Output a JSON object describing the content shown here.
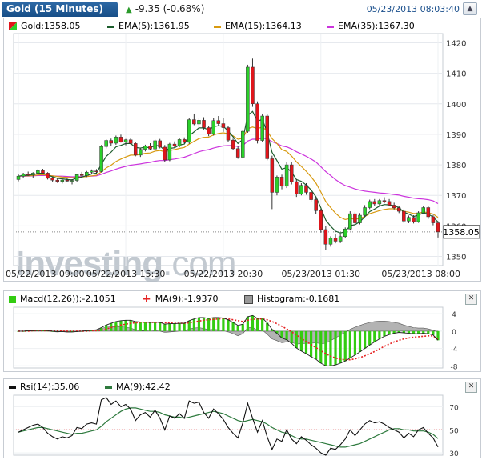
{
  "header": {
    "title": "Gold (15 Minutes)",
    "change": "-9.35 (-0.68%)",
    "timestamp": "05/23/2013 08:03:40"
  },
  "colors": {
    "up": "#2ad12a",
    "down": "#e0151b",
    "ema5": "#1c5c2c",
    "ema15": "#d89a10",
    "ema35": "#cc33dd",
    "macd_up": "#33cc11",
    "signal": "#e52222",
    "histogram": "#999999",
    "rsi": "#111111",
    "rsi_ma": "#2e7a3e"
  },
  "price_legend": {
    "gold": "Gold:1358.05",
    "ema5": "EMA(5):1361.95",
    "ema15": "EMA(15):1364.13",
    "ema35": "EMA(35):1367.30"
  },
  "macd_legend": {
    "macd": "Macd(12,26)):-2.1051",
    "ma": "MA(9):-1.9370",
    "histogram": "Histogram:-0.1681"
  },
  "rsi_legend": {
    "rsi": "Rsi(14):35.06",
    "ma": "MA(9):42.42"
  },
  "watermark": {
    "text": "Investing",
    "suffix": ".com"
  },
  "chart_data": [
    {
      "type": "candlestick",
      "title": "Gold (15 Minutes)",
      "ylim": [
        1347,
        1423
      ],
      "y_ticks": [
        1350,
        1360,
        1370,
        1380,
        1390,
        1400,
        1410,
        1420
      ],
      "x_tick_labels": [
        "05/22/2013 09:00",
        "05/22/2013 15:30",
        "05/22/2013 20:30",
        "05/23/2013 01:30",
        "05/23/2013 08:00"
      ],
      "last_price": "1358.05",
      "last_value": 1358.05,
      "reference_line": 1358.05,
      "ohlc": [
        [
          1375.2,
          1377.0,
          1374.6,
          1376.3
        ],
        [
          1376.3,
          1377.4,
          1375.7,
          1376.9
        ],
        [
          1376.9,
          1377.8,
          1376.4,
          1376.7
        ],
        [
          1376.7,
          1377.6,
          1375.8,
          1377.3
        ],
        [
          1377.3,
          1378.6,
          1376.9,
          1378.1
        ],
        [
          1378.1,
          1378.7,
          1376.9,
          1377.3
        ],
        [
          1377.3,
          1377.6,
          1375.2,
          1375.6
        ],
        [
          1375.6,
          1376.0,
          1374.4,
          1375.0
        ],
        [
          1375.0,
          1375.6,
          1374.1,
          1374.6
        ],
        [
          1374.6,
          1375.3,
          1373.9,
          1375.0
        ],
        [
          1375.0,
          1375.8,
          1374.4,
          1374.7
        ],
        [
          1374.7,
          1375.3,
          1373.6,
          1374.9
        ],
        [
          1374.9,
          1377.1,
          1374.5,
          1376.8
        ],
        [
          1376.8,
          1377.7,
          1376.2,
          1376.5
        ],
        [
          1376.5,
          1378.0,
          1376.0,
          1377.6
        ],
        [
          1377.6,
          1378.5,
          1376.9,
          1378.0
        ],
        [
          1378.0,
          1378.6,
          1377.3,
          1377.8
        ],
        [
          1377.8,
          1386.5,
          1377.5,
          1386.0
        ],
        [
          1386.0,
          1388.4,
          1385.4,
          1388.0
        ],
        [
          1388.0,
          1388.6,
          1386.1,
          1387.1
        ],
        [
          1387.1,
          1389.6,
          1386.6,
          1389.1
        ],
        [
          1389.1,
          1389.9,
          1387.3,
          1387.5
        ],
        [
          1387.5,
          1388.5,
          1386.4,
          1388.2
        ],
        [
          1388.2,
          1388.7,
          1386.7,
          1387.0
        ],
        [
          1387.0,
          1387.5,
          1382.8,
          1383.2
        ],
        [
          1383.2,
          1385.6,
          1382.6,
          1385.1
        ],
        [
          1385.1,
          1386.6,
          1384.4,
          1386.2
        ],
        [
          1386.2,
          1387.1,
          1384.8,
          1385.2
        ],
        [
          1385.2,
          1388.3,
          1384.8,
          1387.9
        ],
        [
          1387.9,
          1388.5,
          1385.4,
          1385.8
        ],
        [
          1385.8,
          1386.5,
          1381.0,
          1381.6
        ],
        [
          1381.6,
          1387.2,
          1381.2,
          1386.8
        ],
        [
          1386.8,
          1387.7,
          1385.6,
          1386.2
        ],
        [
          1386.2,
          1388.8,
          1385.8,
          1388.3
        ],
        [
          1388.3,
          1389.0,
          1387.1,
          1387.4
        ],
        [
          1387.4,
          1395.3,
          1386.9,
          1394.8
        ],
        [
          1394.8,
          1396.8,
          1393.0,
          1393.4
        ],
        [
          1393.4,
          1395.2,
          1392.2,
          1394.6
        ],
        [
          1394.6,
          1395.6,
          1391.6,
          1392.2
        ],
        [
          1392.2,
          1392.8,
          1389.4,
          1390.2
        ],
        [
          1390.2,
          1395.3,
          1389.6,
          1394.5
        ],
        [
          1394.5,
          1396.0,
          1392.9,
          1393.5
        ],
        [
          1393.5,
          1395.4,
          1390.8,
          1392.2
        ],
        [
          1392.2,
          1392.7,
          1387.5,
          1388.1
        ],
        [
          1388.1,
          1388.6,
          1384.8,
          1385.3
        ],
        [
          1385.3,
          1386.0,
          1382.0,
          1382.5
        ],
        [
          1382.5,
          1391.5,
          1382.1,
          1391.0
        ],
        [
          1391.0,
          1412.8,
          1390.5,
          1412.0
        ],
        [
          1412.0,
          1414.8,
          1399.0,
          1400.0
        ],
        [
          1400.0,
          1400.8,
          1387.0,
          1388.0
        ],
        [
          1388.0,
          1396.8,
          1387.4,
          1396.0
        ],
        [
          1396.0,
          1396.8,
          1381.5,
          1382.0
        ],
        [
          1382.0,
          1383.0,
          1365.5,
          1371.0
        ],
        [
          1371.0,
          1376.5,
          1370.0,
          1376.0
        ],
        [
          1376.0,
          1376.8,
          1372.0,
          1373.0
        ],
        [
          1373.0,
          1380.8,
          1372.4,
          1380.0
        ],
        [
          1380.0,
          1380.9,
          1373.6,
          1374.5
        ],
        [
          1374.5,
          1375.3,
          1369.5,
          1370.5
        ],
        [
          1370.5,
          1374.0,
          1370.0,
          1373.3
        ],
        [
          1373.3,
          1374.0,
          1370.2,
          1371.0
        ],
        [
          1371.0,
          1372.0,
          1367.8,
          1368.6
        ],
        [
          1368.6,
          1369.5,
          1364.0,
          1365.0
        ],
        [
          1365.0,
          1365.6,
          1357.8,
          1358.8
        ],
        [
          1358.8,
          1359.9,
          1352.0,
          1354.0
        ],
        [
          1354.0,
          1356.6,
          1353.2,
          1356.0
        ],
        [
          1356.0,
          1357.2,
          1354.3,
          1355.0
        ],
        [
          1355.0,
          1357.2,
          1354.4,
          1356.5
        ],
        [
          1356.5,
          1359.5,
          1356.0,
          1359.0
        ],
        [
          1359.0,
          1364.8,
          1358.5,
          1364.0
        ],
        [
          1364.0,
          1364.6,
          1360.3,
          1361.0
        ],
        [
          1361.0,
          1364.2,
          1360.5,
          1363.5
        ],
        [
          1363.5,
          1366.8,
          1363.0,
          1366.0
        ],
        [
          1366.0,
          1368.6,
          1365.5,
          1368.0
        ],
        [
          1368.0,
          1368.8,
          1366.6,
          1367.2
        ],
        [
          1367.2,
          1368.8,
          1366.6,
          1368.3
        ],
        [
          1368.3,
          1369.4,
          1367.4,
          1368.0
        ],
        [
          1368.0,
          1368.8,
          1366.4,
          1366.8
        ],
        [
          1366.8,
          1367.6,
          1365.4,
          1365.9
        ],
        [
          1365.9,
          1366.5,
          1364.2,
          1364.8
        ],
        [
          1364.8,
          1365.4,
          1361.0,
          1361.6
        ],
        [
          1361.6,
          1363.4,
          1360.9,
          1362.8
        ],
        [
          1362.8,
          1363.5,
          1360.8,
          1361.4
        ],
        [
          1361.4,
          1364.8,
          1361.0,
          1364.3
        ],
        [
          1364.3,
          1366.5,
          1363.8,
          1366.0
        ],
        [
          1366.0,
          1366.5,
          1362.3,
          1363.0
        ],
        [
          1363.0,
          1363.6,
          1360.2,
          1361.0
        ],
        [
          1361.0,
          1361.5,
          1356.2,
          1358.05
        ]
      ],
      "ema5": [
        1376.3,
        1376.5,
        1376.6,
        1376.8,
        1377.2,
        1377.3,
        1376.7,
        1376.1,
        1375.6,
        1375.4,
        1375.2,
        1375.1,
        1375.7,
        1376.0,
        1376.5,
        1377.0,
        1377.3,
        1380.2,
        1382.8,
        1384.2,
        1385.9,
        1386.4,
        1387.0,
        1387.0,
        1385.7,
        1385.5,
        1385.8,
        1385.6,
        1386.4,
        1386.2,
        1384.7,
        1385.4,
        1385.6,
        1386.5,
        1386.8,
        1389.5,
        1390.8,
        1392.1,
        1392.1,
        1391.5,
        1392.5,
        1392.8,
        1392.6,
        1391.1,
        1389.2,
        1387.0,
        1388.3,
        1396.2,
        1397.5,
        1394.3,
        1394.9,
        1390.6,
        1384.1,
        1381.4,
        1378.6,
        1379.1,
        1377.6,
        1375.2,
        1374.6,
        1373.4,
        1371.8,
        1369.5,
        1365.9,
        1361.9,
        1359.9,
        1358.3,
        1357.7,
        1358.1,
        1360.1,
        1360.4,
        1361.4,
        1363.0,
        1364.7,
        1365.5,
        1366.5,
        1367.0,
        1366.9,
        1366.6,
        1366.0,
        1364.5,
        1363.9,
        1363.1,
        1363.5,
        1364.3,
        1363.9,
        1362.9,
        1361.3
      ],
      "ema15": [
        1376.3,
        1376.4,
        1376.4,
        1376.5,
        1376.7,
        1376.8,
        1376.6,
        1376.4,
        1376.2,
        1376.0,
        1375.9,
        1375.8,
        1375.9,
        1376.0,
        1376.2,
        1376.4,
        1376.6,
        1377.7,
        1379.0,
        1379.9,
        1381.1,
        1381.9,
        1382.6,
        1383.2,
        1383.2,
        1383.4,
        1383.8,
        1383.9,
        1384.5,
        1384.7,
        1384.3,
        1384.7,
        1385.0,
        1385.4,
        1385.7,
        1386.8,
        1387.7,
        1388.6,
        1389.0,
        1389.1,
        1389.8,
        1390.3,
        1390.5,
        1390.2,
        1389.5,
        1388.4,
        1388.7,
        1391.9,
        1392.4,
        1391.9,
        1392.4,
        1391.1,
        1388.6,
        1387.0,
        1385.0,
        1384.4,
        1382.9,
        1381.0,
        1379.5,
        1377.9,
        1376.1,
        1374.0,
        1371.1,
        1368.0,
        1366.0,
        1364.2,
        1362.8,
        1362.1,
        1362.4,
        1362.2,
        1362.4,
        1363.1,
        1364.0,
        1364.5,
        1365.0,
        1365.4,
        1365.6,
        1365.6,
        1365.5,
        1364.8,
        1364.5,
        1364.1,
        1364.1,
        1364.6,
        1364.3,
        1363.9,
        1362.8
      ],
      "ema35": [
        1376.3,
        1376.3,
        1376.3,
        1376.4,
        1376.5,
        1376.5,
        1376.5,
        1376.4,
        1376.3,
        1376.3,
        1376.2,
        1376.1,
        1376.1,
        1376.2,
        1376.2,
        1376.3,
        1376.4,
        1376.9,
        1377.5,
        1378.0,
        1378.6,
        1379.1,
        1379.5,
        1379.9,
        1380.1,
        1380.3,
        1380.6,
        1380.8,
        1381.2,
        1381.4,
        1381.4,
        1381.7,
        1381.9,
        1382.2,
        1382.5,
        1383.1,
        1383.7,
        1384.3,
        1384.7,
        1385.0,
        1385.5,
        1385.9,
        1386.2,
        1386.3,
        1386.3,
        1386.0,
        1386.3,
        1387.8,
        1388.4,
        1388.4,
        1388.8,
        1388.5,
        1387.6,
        1387.0,
        1386.2,
        1385.9,
        1385.2,
        1384.3,
        1383.6,
        1382.8,
        1381.9,
        1380.9,
        1379.4,
        1377.8,
        1376.5,
        1375.2,
        1374.1,
        1373.2,
        1372.7,
        1372.1,
        1371.7,
        1371.4,
        1371.2,
        1371.0,
        1370.8,
        1370.7,
        1370.5,
        1370.3,
        1370.1,
        1369.7,
        1369.4,
        1369.1,
        1368.9,
        1368.8,
        1368.6,
        1368.2,
        1367.3
      ]
    },
    {
      "type": "macd",
      "ylim": [
        -8.5,
        5.5
      ],
      "y_ticks": [
        4,
        0,
        -4,
        -8
      ],
      "macd": [
        0,
        0,
        0.1,
        0.1,
        0.2,
        0.2,
        0.1,
        0,
        -0.1,
        -0.1,
        -0.2,
        -0.2,
        -0.1,
        0,
        0.1,
        0.2,
        0.3,
        0.8,
        1.4,
        1.8,
        2.2,
        2.4,
        2.5,
        2.5,
        2.2,
        2.1,
        2.1,
        2.0,
        2.1,
        2.0,
        1.6,
        1.7,
        1.7,
        1.8,
        1.8,
        2.4,
        2.8,
        3.1,
        3.1,
        2.9,
        3.1,
        3.1,
        3.0,
        2.6,
        2.0,
        1.3,
        1.6,
        3.3,
        3.6,
        2.9,
        3.0,
        1.9,
        0.4,
        -0.5,
        -1.6,
        -2.0,
        -2.8,
        -3.9,
        -4.6,
        -5.2,
        -5.9,
        -6.5,
        -7.4,
        -8.0,
        -8.0,
        -7.8,
        -7.4,
        -6.9,
        -6.2,
        -5.5,
        -4.8,
        -4.0,
        -3.2,
        -2.5,
        -1.8,
        -1.2,
        -0.8,
        -0.5,
        -0.3,
        -0.4,
        -0.5,
        -0.6,
        -0.6,
        -0.5,
        -0.6,
        -0.9,
        -2.1051
      ],
      "signal": [
        0,
        0,
        0,
        0.1,
        0.1,
        0.1,
        0.1,
        0.1,
        0.1,
        0,
        0,
        0,
        0,
        0,
        0,
        0.1,
        0.1,
        0.2,
        0.5,
        0.8,
        1.1,
        1.4,
        1.6,
        1.8,
        1.9,
        2.0,
        2.0,
        2.0,
        2.0,
        2.0,
        1.9,
        1.9,
        1.8,
        1.8,
        1.8,
        1.9,
        2.1,
        2.3,
        2.5,
        2.6,
        2.7,
        2.8,
        2.9,
        2.8,
        2.6,
        2.4,
        2.2,
        2.5,
        2.7,
        2.8,
        2.8,
        2.6,
        2.2,
        1.7,
        1.1,
        0.5,
        -0.2,
        -0.9,
        -1.7,
        -2.4,
        -3.1,
        -3.8,
        -4.5,
        -5.2,
        -5.8,
        -6.2,
        -6.5,
        -6.6,
        -6.6,
        -6.4,
        -6.1,
        -5.7,
        -5.2,
        -4.7,
        -4.1,
        -3.5,
        -3.0,
        -2.5,
        -2.1,
        -1.8,
        -1.6,
        -1.4,
        -1.3,
        -1.2,
        -1.1,
        -1.1,
        -1.937
      ],
      "histogram": [
        0,
        0,
        0.1,
        0,
        0.1,
        0.1,
        0,
        -0.1,
        -0.2,
        -0.1,
        -0.2,
        -0.2,
        -0.1,
        0,
        0.1,
        0.1,
        0.2,
        0.6,
        0.9,
        1.0,
        1.1,
        1.0,
        0.9,
        0.7,
        0.3,
        0.1,
        0.1,
        0,
        0.1,
        0,
        -0.3,
        -0.2,
        -0.1,
        0,
        0,
        0.5,
        0.7,
        0.8,
        0.6,
        0.3,
        0.4,
        0.3,
        0.1,
        -0.2,
        -0.6,
        -1.1,
        -0.6,
        0.8,
        0.9,
        0.1,
        0.2,
        -0.7,
        -1.8,
        -2.2,
        -2.7,
        -2.5,
        -2.6,
        -3.0,
        -2.9,
        -2.8,
        -2.8,
        -2.7,
        -2.9,
        -2.8,
        -2.2,
        -1.6,
        -0.9,
        -0.3,
        0.4,
        0.9,
        1.3,
        1.7,
        2.0,
        2.2,
        2.3,
        2.3,
        2.2,
        2.0,
        1.8,
        1.4,
        1.1,
        0.8,
        0.7,
        0.7,
        0.5,
        0.2,
        -0.1681
      ]
    },
    {
      "type": "rsi",
      "ylim": [
        28,
        80
      ],
      "y_ticks": [
        70,
        50,
        30
      ],
      "reference_line": 50,
      "rsi": [
        48,
        50,
        52,
        54,
        55,
        52,
        47,
        44,
        42,
        44,
        43,
        45,
        52,
        51,
        55,
        56,
        55,
        76,
        78,
        72,
        75,
        70,
        72,
        68,
        58,
        63,
        65,
        61,
        67,
        60,
        50,
        62,
        60,
        64,
        60,
        75,
        73,
        74,
        65,
        60,
        68,
        64,
        59,
        52,
        47,
        43,
        56,
        73,
        60,
        48,
        58,
        44,
        33,
        42,
        40,
        50,
        42,
        38,
        44,
        41,
        37,
        34,
        30,
        28,
        34,
        33,
        37,
        42,
        50,
        45,
        50,
        55,
        58,
        56,
        57,
        55,
        52,
        50,
        48,
        43,
        47,
        44,
        50,
        52,
        47,
        43,
        35.06
      ],
      "rsi_ma": [
        48,
        49,
        50,
        51,
        52,
        52,
        51,
        50,
        49,
        48,
        47,
        46,
        47,
        47,
        48,
        49,
        50,
        53,
        57,
        60,
        63,
        66,
        68,
        69,
        69,
        68,
        67,
        66,
        66,
        65,
        63,
        62,
        61,
        61,
        60,
        61,
        62,
        63,
        64,
        65,
        66,
        65,
        64,
        62,
        60,
        58,
        57,
        58,
        59,
        58,
        57,
        55,
        52,
        50,
        48,
        47,
        45,
        43,
        42,
        42,
        41,
        40,
        39,
        38,
        37,
        36,
        35,
        35,
        36,
        37,
        38,
        40,
        42,
        44,
        46,
        48,
        50,
        51,
        51,
        50,
        50,
        49,
        49,
        49,
        48,
        46,
        42.42
      ]
    }
  ]
}
